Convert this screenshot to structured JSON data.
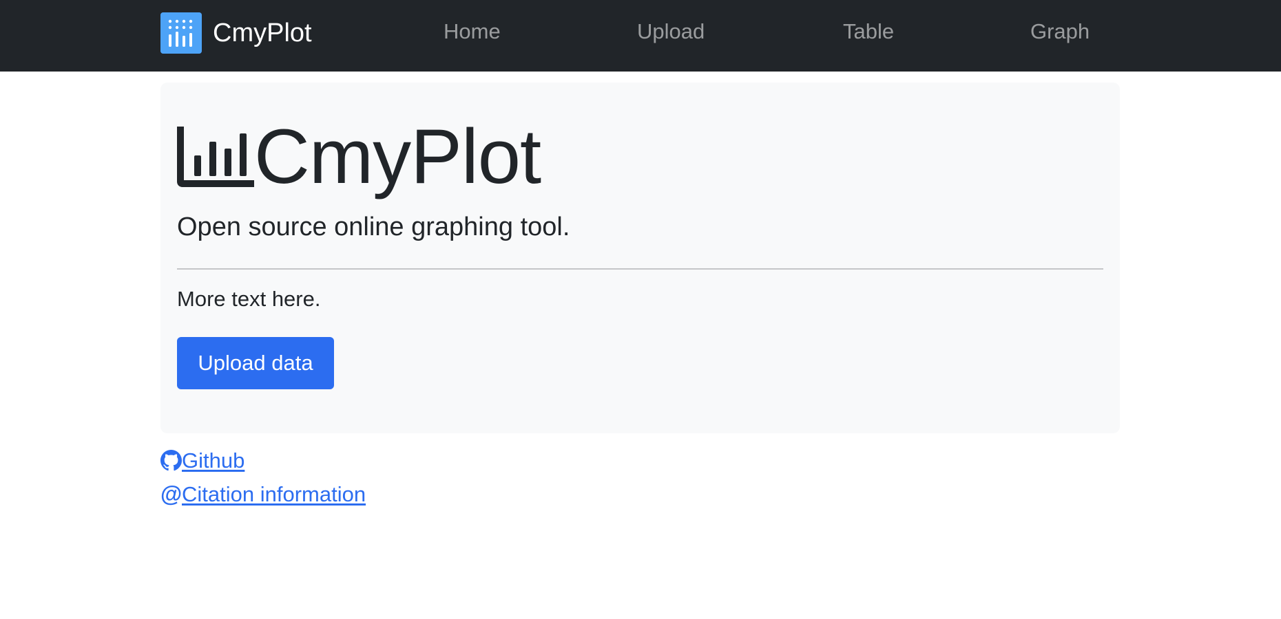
{
  "navbar": {
    "brand": "CmyPlot",
    "links": [
      "Home",
      "Upload",
      "Table",
      "Graph"
    ]
  },
  "hero": {
    "title": "CmyPlot",
    "lead": "Open source online graphing tool.",
    "more_text": "More text here.",
    "upload_button": "Upload data"
  },
  "footer": {
    "github_label": "Github",
    "citation_label": "Citation information",
    "citation_glyph": "@"
  },
  "colors": {
    "navbar_bg": "#212529",
    "brand_logo_bg": "#4da3f7",
    "jumbotron_bg": "#f8f9fa",
    "primary": "#2c6df0",
    "link": "#2c6df0"
  },
  "icons": {
    "brand_logo": "bar-chart-dots-icon",
    "hero_icon": "bar-chart-icon",
    "github": "github-icon"
  }
}
